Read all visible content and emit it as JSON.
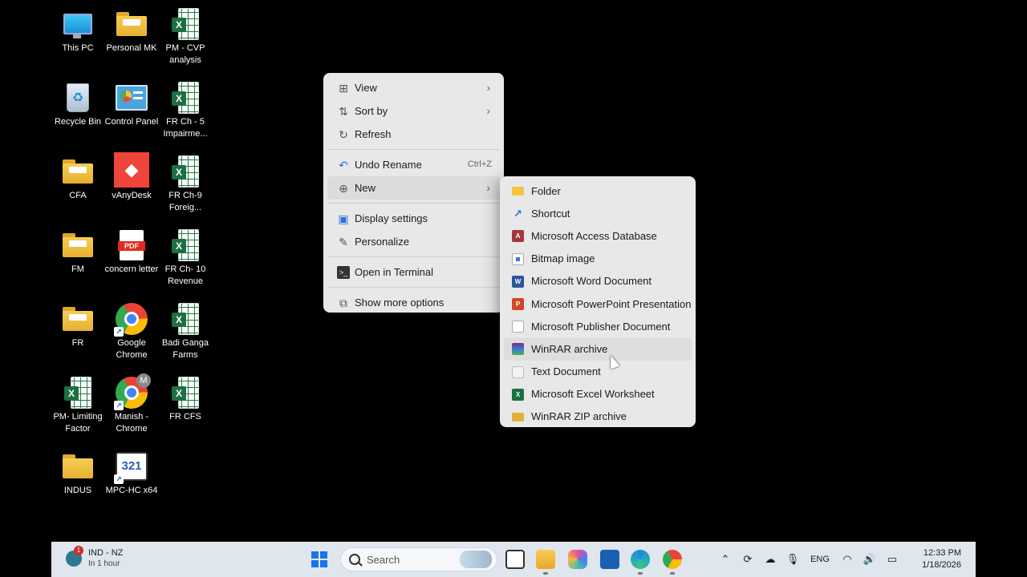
{
  "desktop_icons": [
    {
      "label": "This PC",
      "icon": "monitor-icon"
    },
    {
      "label": "Personal MK",
      "icon": "folder-icon"
    },
    {
      "label": "PM - CVP analysis",
      "icon": "excel-file-icon"
    },
    {
      "label": "Recycle Bin",
      "icon": "recycle-bin-icon"
    },
    {
      "label": "Control Panel",
      "icon": "control-panel-icon"
    },
    {
      "label": "FR Ch - 5 Impairme...",
      "icon": "excel-file-icon"
    },
    {
      "label": "CFA",
      "icon": "folder-icon"
    },
    {
      "label": "vAnyDesk",
      "icon": "anydesk-icon"
    },
    {
      "label": "FR Ch-9 Foreig...",
      "icon": "excel-file-icon"
    },
    {
      "label": "FM",
      "icon": "folder-icon"
    },
    {
      "label": "concern letter",
      "icon": "pdf-file-icon"
    },
    {
      "label": "FR Ch- 10 Revenue",
      "icon": "excel-file-icon"
    },
    {
      "label": "FR",
      "icon": "folder-icon"
    },
    {
      "label": "Google Chrome",
      "icon": "chrome-icon"
    },
    {
      "label": "Badi Ganga Farms",
      "icon": "excel-file-icon"
    },
    {
      "label": "PM- Limiting Factor",
      "icon": "excel-file-icon"
    },
    {
      "label": "Manish - Chrome",
      "icon": "chrome-profile-icon",
      "badge": "M"
    },
    {
      "label": "FR CFS",
      "icon": "excel-file-icon"
    },
    {
      "label": "INDUS",
      "icon": "folder-icon"
    },
    {
      "label": "MPC-HC x64",
      "icon": "mpc-hc-icon",
      "badge": "321"
    }
  ],
  "pdf_badge": "PDF",
  "excel_letter": "X",
  "context_menu": {
    "view": "View",
    "sort_by": "Sort by",
    "refresh": "Refresh",
    "undo_rename": "Undo Rename",
    "undo_shortcut": "Ctrl+Z",
    "new": "New",
    "display_settings": "Display settings",
    "personalize": "Personalize",
    "open_terminal": "Open in Terminal",
    "show_more": "Show more options"
  },
  "new_submenu": [
    {
      "label": "Folder",
      "icon": "folder-icon",
      "color": "#f5c542"
    },
    {
      "label": "Shortcut",
      "icon": "shortcut-arrow-icon",
      "color": "#2a6fdb"
    },
    {
      "label": "Microsoft Access Database",
      "icon": "access-icon",
      "color": "#a4373a"
    },
    {
      "label": "Bitmap image",
      "icon": "bitmap-icon",
      "color": "#3a7bd5"
    },
    {
      "label": "Microsoft Word Document",
      "icon": "word-icon",
      "color": "#2b579a"
    },
    {
      "label": "Microsoft PowerPoint Presentation",
      "icon": "powerpoint-icon",
      "color": "#d24726"
    },
    {
      "label": "Microsoft Publisher Document",
      "icon": "blank-document-icon",
      "color": "#ffffff"
    },
    {
      "label": "WinRAR archive",
      "icon": "winrar-icon",
      "color": "#7a2f8a"
    },
    {
      "label": "Text Document",
      "icon": "text-document-icon",
      "color": "#f2f2f2"
    },
    {
      "label": "Microsoft Excel Worksheet",
      "icon": "excel-icon",
      "color": "#1d6f42"
    },
    {
      "label": "WinRAR ZIP archive",
      "icon": "zip-icon",
      "color": "#e0b23a"
    }
  ],
  "taskbar": {
    "weather_location": "IND - NZ",
    "weather_sub": "In 1 hour",
    "notification_count": "1",
    "search_placeholder": "Search",
    "language": "ENG",
    "time": "12:33 PM",
    "date": "1/18/2026"
  }
}
